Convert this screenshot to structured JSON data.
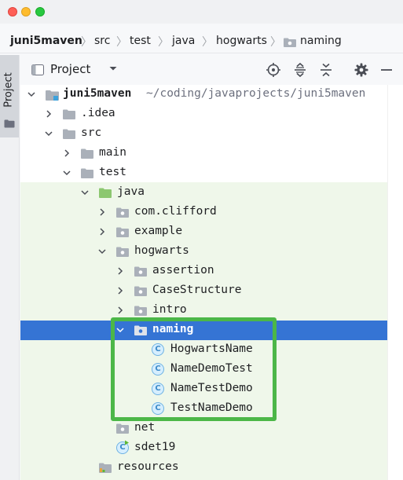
{
  "breadcrumb": [
    "juni5maven",
    "src",
    "test",
    "java",
    "hogwarts",
    "naming"
  ],
  "sidebar": {
    "tab_label": "Project"
  },
  "toolbar": {
    "view_label": "Project"
  },
  "tree": [
    {
      "label": "juni5maven",
      "path": "~/coding/javaprojects/juni5maven",
      "icon": "module-folder-icon",
      "expanded": true
    },
    {
      "label": ".idea",
      "icon": "folder-icon",
      "expanded": false
    },
    {
      "label": "src",
      "icon": "folder-icon",
      "expanded": true
    },
    {
      "label": "main",
      "icon": "folder-icon",
      "expanded": false
    },
    {
      "label": "test",
      "icon": "folder-icon",
      "expanded": true
    },
    {
      "label": "java",
      "icon": "test-source-folder-icon",
      "expanded": true
    },
    {
      "label": "com.clifford",
      "icon": "package-icon",
      "expanded": false
    },
    {
      "label": "example",
      "icon": "package-icon",
      "expanded": false
    },
    {
      "label": "hogwarts",
      "icon": "package-icon",
      "expanded": true
    },
    {
      "label": "assertion",
      "icon": "package-icon",
      "expanded": false
    },
    {
      "label": "CaseStructure",
      "icon": "package-icon",
      "expanded": false
    },
    {
      "label": "intro",
      "icon": "package-icon",
      "expanded": false
    },
    {
      "label": "naming",
      "icon": "package-icon",
      "expanded": true,
      "selected": true
    },
    {
      "label": "HogwartsName",
      "icon": "class-icon",
      "glyph": "C"
    },
    {
      "label": "NameDemoTest",
      "icon": "class-icon",
      "glyph": "C"
    },
    {
      "label": "NameTestDemo",
      "icon": "class-icon",
      "glyph": "C"
    },
    {
      "label": "TestNameDemo",
      "icon": "class-icon",
      "glyph": "C"
    },
    {
      "label": "net",
      "icon": "package-icon"
    },
    {
      "label": "sdet19",
      "icon": "class-icon",
      "glyph": "C"
    },
    {
      "label": "resources",
      "icon": "test-resources-folder-icon"
    }
  ],
  "colors": {
    "selection": "#3574d4",
    "test_background": "#eff7ea",
    "highlight_border": "#4cb748",
    "folder": "#aab0b9",
    "test_folder": "#8cc770"
  }
}
